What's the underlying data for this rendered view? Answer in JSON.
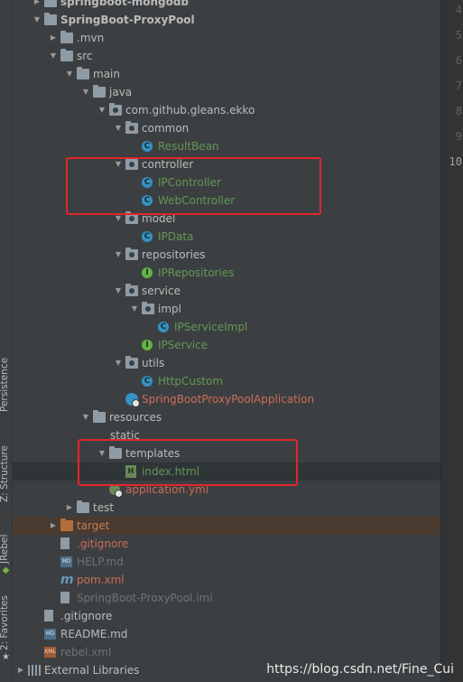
{
  "side_tabs": {
    "persistence": "Persistence",
    "structure": "Z: Structure",
    "jrebel": "JRebel",
    "favorites": "2: Favorites"
  },
  "tree": [
    {
      "label": "springboot-mongodb",
      "depth": 0,
      "arrow": "closed",
      "icon": "folder",
      "color": "normal"
    },
    {
      "label": "SpringBoot-ProxyPool",
      "depth": 0,
      "arrow": "open",
      "icon": "folder",
      "color": "normal"
    },
    {
      "label": ".mvn",
      "depth": 1,
      "arrow": "closed",
      "icon": "folder",
      "color": "normal"
    },
    {
      "label": "src",
      "depth": 1,
      "arrow": "open",
      "icon": "folder",
      "color": "normal"
    },
    {
      "label": "main",
      "depth": 2,
      "arrow": "open",
      "icon": "folder",
      "color": "normal"
    },
    {
      "label": "java",
      "depth": 3,
      "arrow": "open",
      "icon": "folder",
      "color": "normal"
    },
    {
      "label": "com.github.gleans.ekko",
      "depth": 4,
      "arrow": "open",
      "icon": "package",
      "color": "normal"
    },
    {
      "label": "common",
      "depth": 5,
      "arrow": "open",
      "icon": "package",
      "color": "normal"
    },
    {
      "label": "ResultBean",
      "depth": 6,
      "arrow": "none",
      "icon": "class",
      "color": "green"
    },
    {
      "label": "controller",
      "depth": 5,
      "arrow": "open",
      "icon": "package",
      "color": "normal"
    },
    {
      "label": "IPController",
      "depth": 6,
      "arrow": "none",
      "icon": "class",
      "color": "green"
    },
    {
      "label": "WebController",
      "depth": 6,
      "arrow": "none",
      "icon": "class",
      "color": "green"
    },
    {
      "label": "model",
      "depth": 5,
      "arrow": "open",
      "icon": "package",
      "color": "normal"
    },
    {
      "label": "IPData",
      "depth": 6,
      "arrow": "none",
      "icon": "class",
      "color": "green"
    },
    {
      "label": "repositories",
      "depth": 5,
      "arrow": "open",
      "icon": "package",
      "color": "normal"
    },
    {
      "label": "IPRepositories",
      "depth": 6,
      "arrow": "none",
      "icon": "interface",
      "color": "green"
    },
    {
      "label": "service",
      "depth": 5,
      "arrow": "open",
      "icon": "package",
      "color": "normal"
    },
    {
      "label": "impl",
      "depth": 6,
      "arrow": "open",
      "icon": "package",
      "color": "normal"
    },
    {
      "label": "IPServiceImpl",
      "depth": 7,
      "arrow": "none",
      "icon": "class",
      "color": "green"
    },
    {
      "label": "IPService",
      "depth": 6,
      "arrow": "none",
      "icon": "interface",
      "color": "green"
    },
    {
      "label": "utils",
      "depth": 5,
      "arrow": "open",
      "icon": "package",
      "color": "normal"
    },
    {
      "label": "HttpCustom",
      "depth": 6,
      "arrow": "none",
      "icon": "class",
      "color": "green"
    },
    {
      "label": "SpringBootProxyPoolApplication",
      "depth": 5,
      "arrow": "none",
      "icon": "spring-class",
      "color": "red"
    },
    {
      "label": "resources",
      "depth": 3,
      "arrow": "open",
      "icon": "folder",
      "color": "normal"
    },
    {
      "label": "static",
      "depth": 4,
      "arrow": "none",
      "icon": "none",
      "color": "normal"
    },
    {
      "label": "templates",
      "depth": 4,
      "arrow": "open",
      "icon": "folder",
      "color": "normal"
    },
    {
      "label": "index.html",
      "depth": 5,
      "arrow": "none",
      "icon": "html",
      "color": "html",
      "selected": true
    },
    {
      "label": "application.yml",
      "depth": 4,
      "arrow": "none",
      "icon": "yml",
      "color": "red"
    },
    {
      "label": "test",
      "depth": 2,
      "arrow": "closed",
      "icon": "folder",
      "color": "normal"
    },
    {
      "label": "target",
      "depth": 1,
      "arrow": "closed",
      "icon": "folder-orange",
      "color": "orange",
      "excluded": true
    },
    {
      "label": ".gitignore",
      "depth": 1,
      "arrow": "none",
      "icon": "file",
      "color": "red"
    },
    {
      "label": "HELP.md",
      "depth": 1,
      "arrow": "none",
      "icon": "md",
      "color": "dim"
    },
    {
      "label": "pom.xml",
      "depth": 1,
      "arrow": "none",
      "icon": "maven",
      "color": "red"
    },
    {
      "label": "SpringBoot-ProxyPool.iml",
      "depth": 1,
      "arrow": "none",
      "icon": "file",
      "color": "dim"
    },
    {
      "label": ".gitignore",
      "depth": 0,
      "arrow": "none",
      "icon": "file",
      "color": "normal"
    },
    {
      "label": "README.md",
      "depth": 0,
      "arrow": "none",
      "icon": "md",
      "color": "normal"
    },
    {
      "label": "rebel.xml",
      "depth": 0,
      "arrow": "none",
      "icon": "xml",
      "color": "dim"
    },
    {
      "label": "External Libraries",
      "depth": -1,
      "arrow": "closed",
      "icon": "library",
      "color": "normal"
    }
  ],
  "gutter_lines": [
    "4",
    "5",
    "6",
    "7",
    "8",
    "9",
    "10"
  ],
  "watermark": "https://blog.csdn.net/Fine_Cui",
  "colors": {
    "background": "#3c3f41",
    "highlight_box": "#e0262c",
    "class_green": "#629755",
    "unversioned_red": "#cc6b5a"
  }
}
